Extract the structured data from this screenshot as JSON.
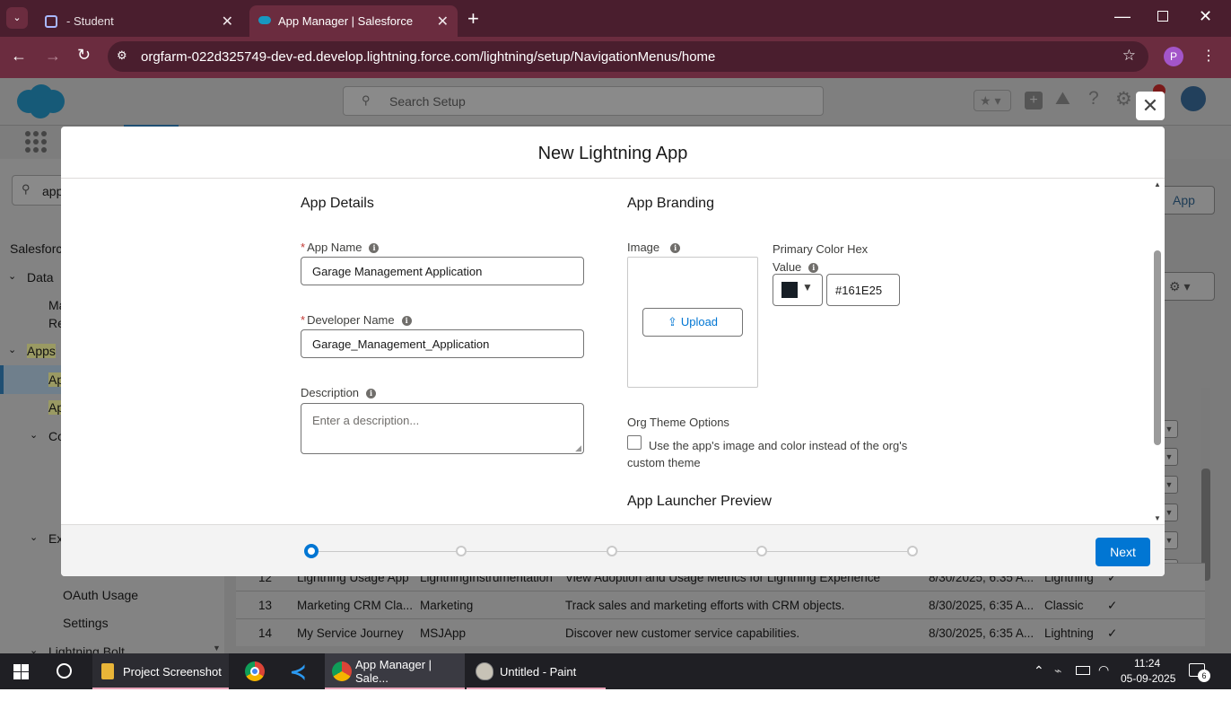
{
  "browser": {
    "tabs": [
      {
        "title": "- Student"
      },
      {
        "title": "App Manager | Salesforce"
      }
    ],
    "new_tab": "+",
    "url": "orgfarm-022d325749-dev-ed.develop.lightning.force.com/lightning/setup/NavigationMenus/home",
    "profile_initial": "P"
  },
  "salesforce": {
    "search_placeholder": "Search Setup",
    "quick_find_value": "app",
    "new_app_btn": "App",
    "sidebar": {
      "salesforce": "Salesforce",
      "data": "Data",
      "ma": "Ma",
      "re": "Re",
      "apps": "Apps",
      "ap1": "Ap",
      "ap2": "Ap",
      "co": "Co",
      "ex": "Ex",
      "oauth": "OAuth Usage",
      "settings": "Settings",
      "lightning_bolt": "Lightning Bolt"
    },
    "rows": [
      {
        "num": "12",
        "name": "Lightning Usage App",
        "dev": "LightningInstrumentation",
        "desc": "View Adoption and Usage Metrics for Lightning Experience",
        "date": "8/30/2025, 6:35 A...",
        "type": "Lightning",
        "check": "✓"
      },
      {
        "num": "13",
        "name": "Marketing CRM Cla...",
        "dev": "Marketing",
        "desc": "Track sales and marketing efforts with CRM objects.",
        "date": "8/30/2025, 6:35 A...",
        "type": "Classic",
        "check": "✓"
      },
      {
        "num": "14",
        "name": "My Service Journey",
        "dev": "MSJApp",
        "desc": "Discover new customer service capabilities.",
        "date": "8/30/2025, 6:35 A...",
        "type": "Lightning",
        "check": "✓"
      }
    ]
  },
  "modal": {
    "title": "New Lightning App",
    "close": "✕",
    "app_details": "App Details",
    "app_name_label": "App Name",
    "app_name_value": "Garage Management Application",
    "dev_name_label": "Developer Name",
    "dev_name_value": "Garage_Management_Application",
    "description_label": "Description",
    "description_placeholder": "Enter a description...",
    "app_branding": "App Branding",
    "image_label": "Image",
    "upload_label": "Upload",
    "primary_color_label_1": "Primary Color Hex",
    "primary_color_label_2": "Value",
    "primary_color_value": "#161E25",
    "primary_color_swatch": "#161E25",
    "org_theme_label": "Org Theme Options",
    "org_theme_checkbox_1": "Use the app's image and color instead of the org's",
    "org_theme_checkbox_2": "custom theme",
    "org_theme_checked": false,
    "launcher_preview": "App Launcher Preview",
    "next_label": "Next",
    "steps_total": 5,
    "current_step": 1
  },
  "taskbar": {
    "items": [
      {
        "label": "Project Screenshot"
      },
      {
        "label": "App Manager | Sale..."
      },
      {
        "label": "Untitled - Paint"
      }
    ],
    "time": "11:24",
    "date": "05-09-2025",
    "notifications": "6"
  },
  "colors": {
    "brand_blue": "#0176d3",
    "chrome_dark": "#4a1e2e",
    "chrome_mid": "#6b2c3f"
  }
}
